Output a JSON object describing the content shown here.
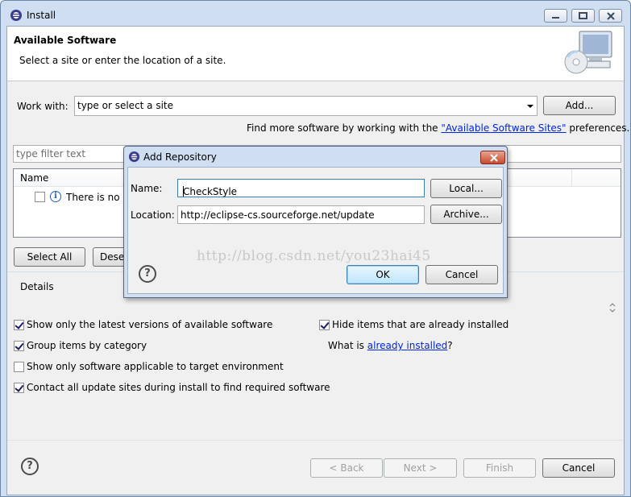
{
  "window": {
    "title": "Install",
    "header_title": "Available Software",
    "header_subtitle": "Select a site or enter the location of a site."
  },
  "work_with": {
    "label": "Work with:",
    "combo_value": "type or select a site",
    "add_button": "Add...",
    "more_prefix": "Find more software by working with the ",
    "more_link": "\"Available Software Sites\"",
    "more_suffix": " preferences."
  },
  "filter": {
    "placeholder": "type filter text"
  },
  "tree": {
    "column_name": "Name",
    "row_text": "There is no s"
  },
  "buttons": {
    "select_all": "Select All",
    "deselect_all": "Dese"
  },
  "details": {
    "label": "Details"
  },
  "options": {
    "latest_versions": {
      "label": "Show only the latest versions of available software",
      "checked": true
    },
    "group_by_category": {
      "label": "Group items by category",
      "checked": true
    },
    "target_env": {
      "label": "Show only software applicable to target environment",
      "checked": false
    },
    "contact_sites": {
      "label": "Contact all update sites during install to find required software",
      "checked": true
    },
    "hide_installed": {
      "label": "Hide items that are already installed",
      "checked": true
    },
    "what_is_prefix": "What is ",
    "what_is_link": "already installed",
    "what_is_suffix": "?"
  },
  "footer": {
    "back": "< Back",
    "next": "Next >",
    "finish": "Finish",
    "cancel": "Cancel"
  },
  "dialog": {
    "title": "Add Repository",
    "name_label": "Name:",
    "name_value": "CheckStyle",
    "location_label": "Location:",
    "location_value": "http://eclipse-cs.sourceforge.net/update",
    "local_button": "Local...",
    "archive_button": "Archive...",
    "ok_button": "OK",
    "cancel_button": "Cancel"
  },
  "watermark": "http://blog.csdn.net/you23hai45"
}
